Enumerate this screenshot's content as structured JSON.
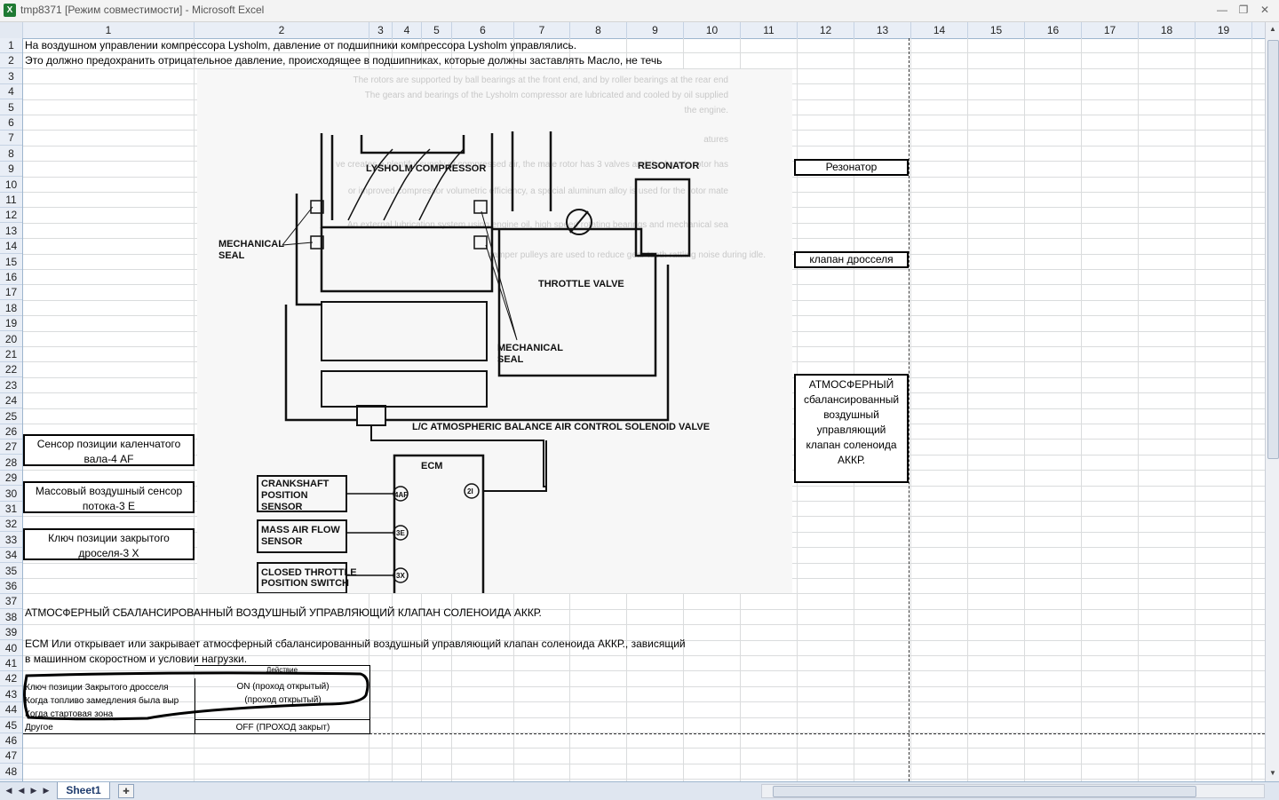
{
  "window": {
    "title": "tmp8371  [Режим совместимости] - Microsoft Excel",
    "icon": "excel-icon",
    "controls": [
      "minimize-icon",
      "restore-icon",
      "close-icon"
    ]
  },
  "columns": [
    "1",
    "2",
    "3",
    "4",
    "5",
    "6",
    "7",
    "8",
    "9",
    "10",
    "11",
    "12",
    "13",
    "14",
    "15",
    "16",
    "17",
    "18",
    "19"
  ],
  "rows": [
    "1",
    "2",
    "3",
    "4",
    "5",
    "6",
    "7",
    "8",
    "9",
    "10",
    "11",
    "12",
    "13",
    "14",
    "15",
    "16",
    "17",
    "18",
    "19",
    "20",
    "21",
    "22",
    "23",
    "24",
    "25",
    "26",
    "27",
    "28",
    "29",
    "30",
    "31",
    "32",
    "33",
    "34",
    "35",
    "36",
    "37",
    "38",
    "39",
    "40",
    "41",
    "42",
    "43",
    "44",
    "45",
    "46",
    "47",
    "48",
    "49"
  ],
  "cells": {
    "r1": "На воздушном управлении компрессора Lysholm, давление от подшипники компрессора Lysholm управлялись.",
    "r2": "Это должно предохранить отрицательное давление, происходящее в подшипниках, которые должны заставлять Масло,  не течь",
    "r38": "АТМОСФЕРНЫЙ СБАЛАНСИРОВАННЫЙ ВОЗДУШНЫЙ УПРАВЛЯЮЩИЙ КЛАПАН СОЛЕНОИДА АККР.",
    "r40": "  ECM Или открывает или закрывает атмосферный сбалансированный воздушный управляющий клапан соленоида АККР., зависящий",
    "r41": "в машинном скоростном и условии нагрузки."
  },
  "callouts": {
    "resonator": "Резонатор",
    "throttle": "клапан дросселя",
    "solenoid": "АТМОСФЕРНЫЙ сбаланси­рованный воздушный управляющий клапан соленоида АККР.",
    "crankshaft": "Сенсор позиции каленчатого вала-4 AF",
    "maf": "Массовый воздушный сенсор потока-3 E",
    "ctp": "Ключ позиции закрытого дроселя-3 X"
  },
  "diagram": {
    "lysholm": "LYSHOLM COMPRESSOR",
    "resonator": "RESONATOR",
    "mech_seal_1a": "MECHANICAL",
    "mech_seal_1b": "SEAL",
    "mech_seal_2a": "MECHANICAL",
    "mech_seal_2b": "SEAL",
    "throttle": "THROTTLE VALVE",
    "solenoid": "L/C ATMOSPHERIC BALANCE AIR CONTROL SOLENOID VALVE",
    "ecm": "ECM",
    "cps_a": "CRANKSHAFT",
    "cps_b": "POSITION",
    "cps_c": "SENSOR",
    "maf_a": "MASS AIR FLOW",
    "maf_b": "SENSOR",
    "ctp_a": "CLOSED THROTTLE",
    "ctp_b": "POSITION SWITCH",
    "pin_4af": "4AF",
    "pin_3e": "3E",
    "pin_3x": "3X",
    "pin_2i": "2I",
    "bg_text": [
      "The rotors are supported by ball bearings at the front end, and by roller bearings at the rear end",
      "The gears and bearings of the Lysholm compressor are lubricated and cooled by oil supplied",
      "the engine.",
      "atures",
      "ve creates a plentiful supply of compressed air, the male rotor has 3 valves and the female rotor has",
      "or improved compressor volumetric efficiency, a special aluminum alloy is used for the rotor mate",
      "An external lubrication system using engine oil, high speed rotating bearings and mechanical sea",
      "damper pulleys are used to reduce gear teeth rattling noise during idle."
    ]
  },
  "table": {
    "header": "Действие",
    "rows": [
      {
        "cond": "Ключ позиции Закрытого дросселя",
        "action": "ON (проход открытый)"
      },
      {
        "cond": "Когда топливо замедления была выр",
        "action": "(проход открытый)"
      },
      {
        "cond": "Когда стартовая зона",
        "action": ""
      },
      {
        "cond": "Другое",
        "action": "OFF (ПРОХОД закрыт)"
      }
    ]
  },
  "sheet_tabs": [
    "Sheet1"
  ]
}
